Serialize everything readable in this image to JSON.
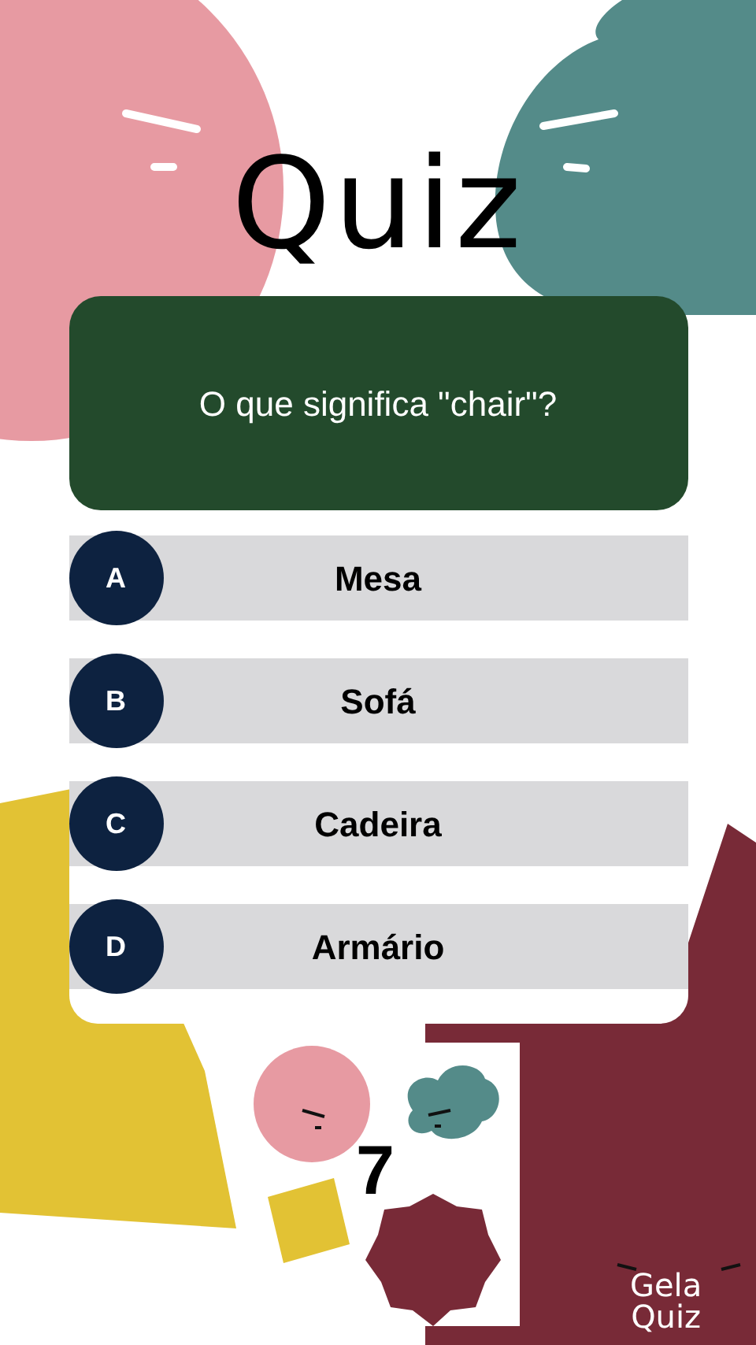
{
  "title": "Quiz",
  "question": "O que significa \"chair\"?",
  "options": [
    {
      "letter": "A",
      "text": "Mesa"
    },
    {
      "letter": "B",
      "text": "Sofá"
    },
    {
      "letter": "C",
      "text": "Cadeira"
    },
    {
      "letter": "D",
      "text": "Armário"
    }
  ],
  "timer": "7",
  "logo": [
    "Gela",
    "Quiz"
  ]
}
